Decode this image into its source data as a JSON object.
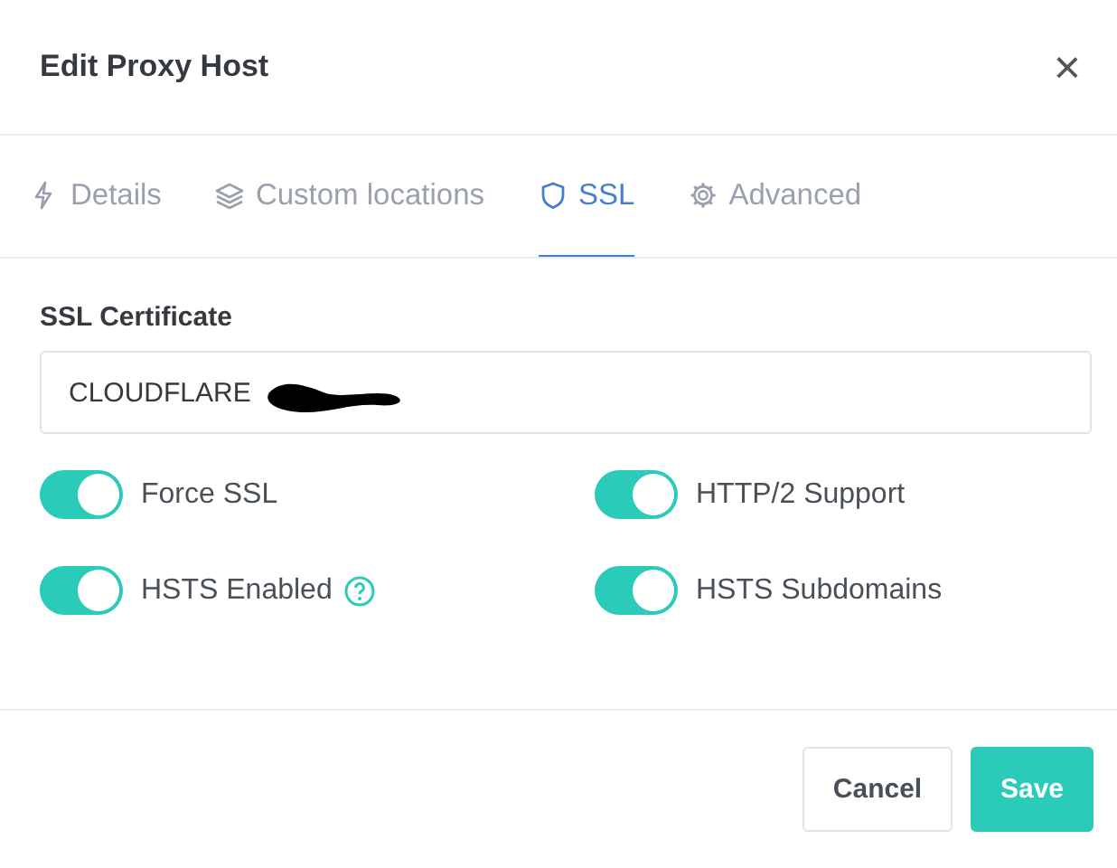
{
  "modal": {
    "title": "Edit Proxy Host",
    "close": "×"
  },
  "tabs": [
    {
      "label": "Details",
      "kind": "bolt",
      "selected": false
    },
    {
      "label": "Custom locations",
      "kind": "layers",
      "selected": false
    },
    {
      "label": "SSL",
      "kind": "shield",
      "selected": true
    },
    {
      "label": "Advanced",
      "kind": "gear",
      "selected": false
    }
  ],
  "ssl_certificate": {
    "label": "SSL Certificate",
    "value": "CLOUDFLARE"
  },
  "toggles": [
    {
      "label": "Force SSL",
      "on": true,
      "help": false
    },
    {
      "label": "HTTP/2 Support",
      "on": true,
      "help": false
    },
    {
      "label": "HSTS Enabled",
      "on": true,
      "help": true
    },
    {
      "label": "HSTS Subdomains",
      "on": true,
      "help": false
    }
  ],
  "buttons": [
    {
      "label": "Cancel",
      "kind": "secondary"
    },
    {
      "label": "Save",
      "kind": "primary"
    }
  ]
}
